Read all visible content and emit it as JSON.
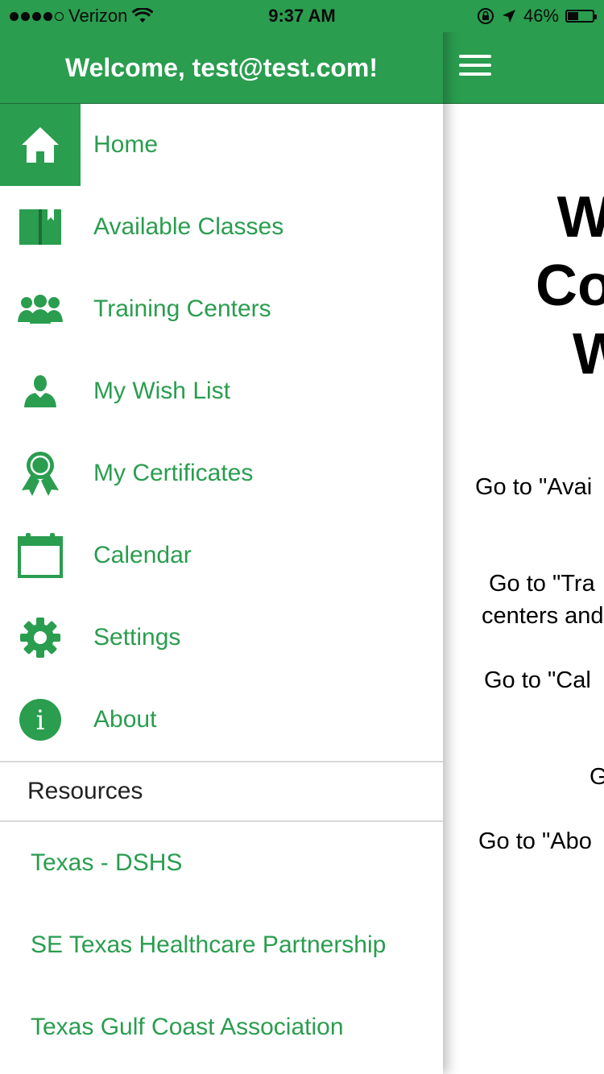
{
  "status_bar": {
    "carrier": "Verizon",
    "time": "9:37 AM",
    "battery": "46%",
    "battery_level": 0.46
  },
  "drawer": {
    "welcome": "Welcome, test@test.com!",
    "items": [
      {
        "label": "Home",
        "icon": "home-icon",
        "active": true
      },
      {
        "label": "Available Classes",
        "icon": "book-icon"
      },
      {
        "label": "Training Centers",
        "icon": "group-icon"
      },
      {
        "label": "My Wish List",
        "icon": "person-icon"
      },
      {
        "label": "My Certificates",
        "icon": "ribbon-icon"
      },
      {
        "label": "Calendar",
        "icon": "calendar-icon"
      },
      {
        "label": "Settings",
        "icon": "gear-icon"
      },
      {
        "label": "About",
        "icon": "info-icon"
      }
    ],
    "resources_header": "Resources",
    "resources": [
      "Texas - DSHS",
      "SE Texas Healthcare Partnership",
      "Texas Gulf Coast Association"
    ]
  },
  "main": {
    "title_lines": [
      "We",
      "Com",
      "W"
    ],
    "lines": [
      "Go to \"Avai",
      "Go to \"Tra",
      "centers and",
      "Go to \"Cal",
      "G",
      "Go to \"Abo"
    ]
  },
  "colors": {
    "accent": "#2a9d4f",
    "header_border": "#1f6b37"
  }
}
